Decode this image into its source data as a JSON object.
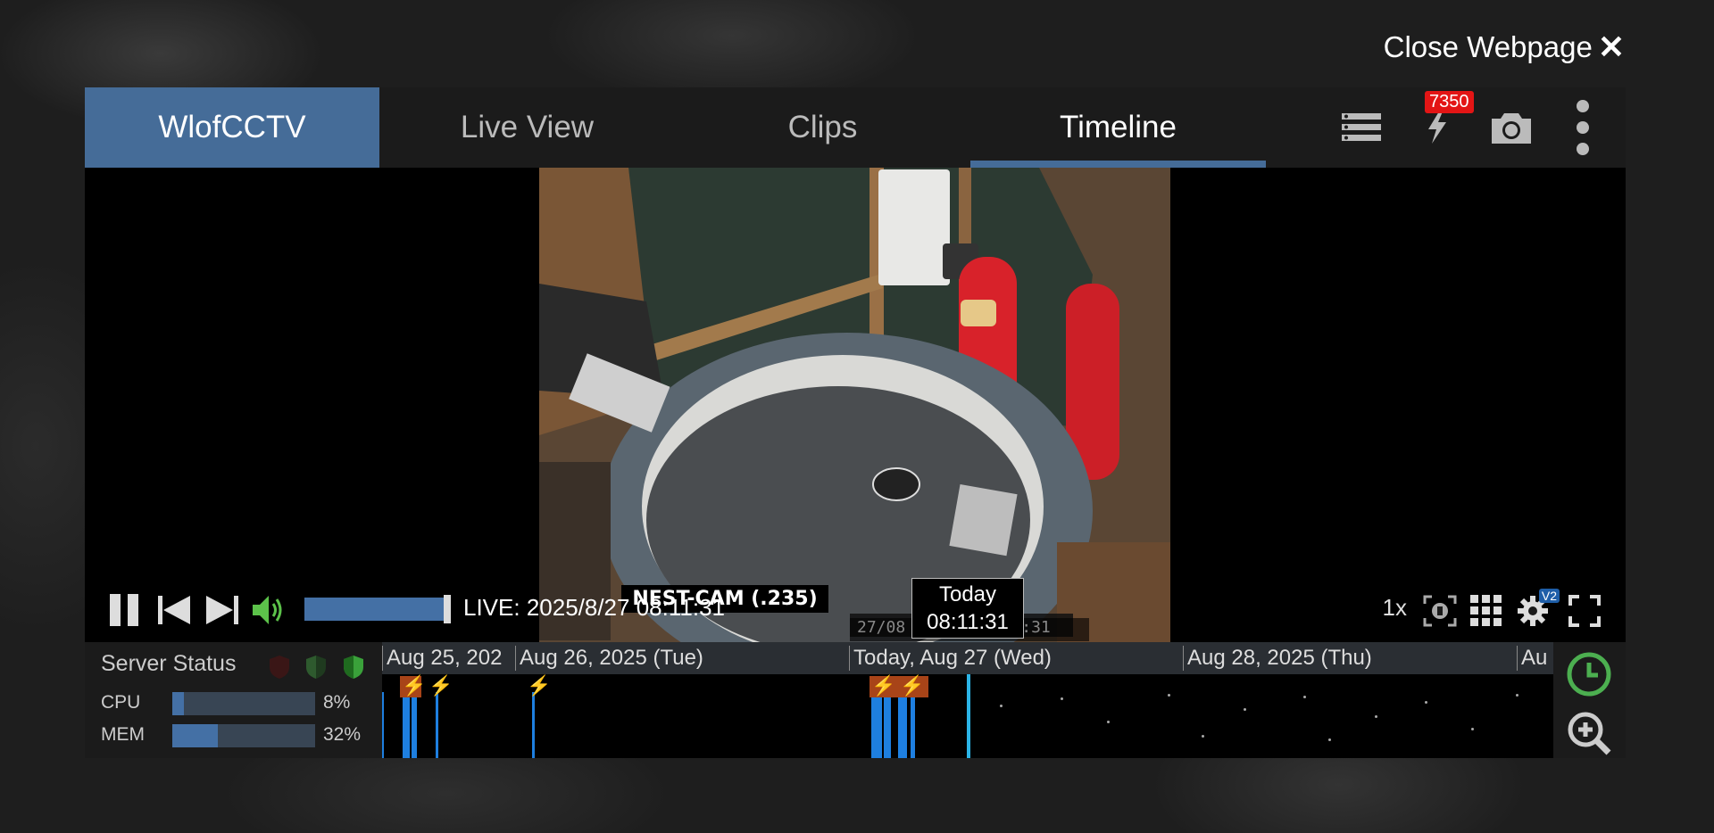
{
  "close": {
    "label": "Close Webpage"
  },
  "tabs": [
    {
      "label": "WlofCCTV"
    },
    {
      "label": "Live View"
    },
    {
      "label": "Clips"
    },
    {
      "label": "Timeline"
    }
  ],
  "toolbar": {
    "alerts_count": "7350",
    "icons": [
      "list-icon",
      "bolt-icon",
      "camera-icon",
      "more-vertical-icon"
    ]
  },
  "camera": {
    "name": "NEST-CAM (.235)",
    "overlay_timestamp": "27/08           1:31"
  },
  "player": {
    "live_text": "LIVE: 2025/8/27 08:11:31",
    "volume_percent": 100,
    "speed": "1x",
    "settings_badge": "V2"
  },
  "tooltip": {
    "line1": "Today",
    "line2": "08:11:31"
  },
  "server_status": {
    "title": "Server Status",
    "cpu_label": "CPU",
    "cpu_value": "8%",
    "cpu_fraction": 0.08,
    "mem_label": "MEM",
    "mem_value": "32%",
    "mem_fraction": 0.32
  },
  "timeline": {
    "dates": [
      "Aug 25, 202",
      "Aug 26, 2025 (Tue)",
      "Today, Aug 27 (Wed)",
      "Aug 28, 2025 (Thu)",
      "Au"
    ]
  },
  "colors": {
    "accent": "#456c98",
    "event_bar": "#1e7fe0",
    "alert_bolt": "#ff5a10",
    "now_line": "#2bb4e6",
    "badge": "#e31515",
    "clock_green": "#4caf50"
  }
}
